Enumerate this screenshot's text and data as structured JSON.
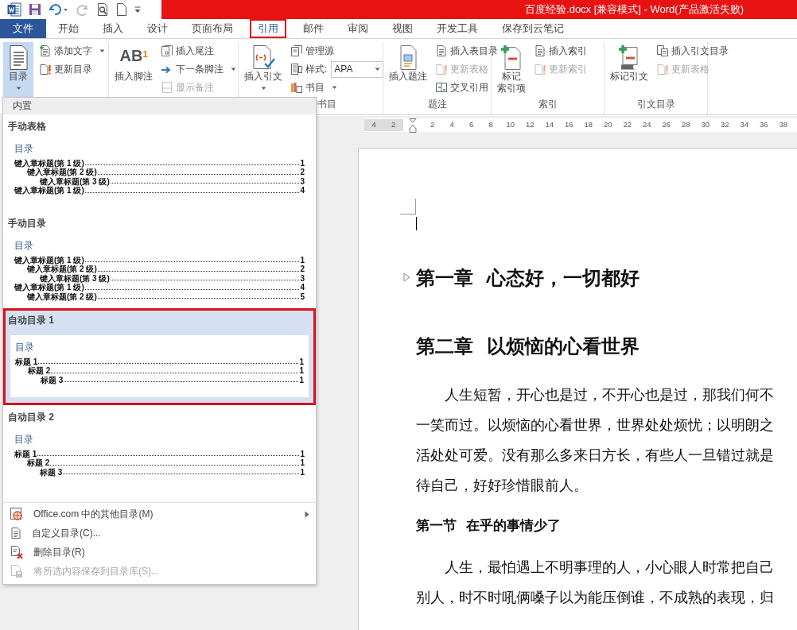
{
  "window": {
    "title": "百度经验.docx [兼容模式] -  Word(产品激活失败)"
  },
  "quick_access": [
    {
      "disabled": false
    },
    {
      "disabled": false
    },
    {
      "disabled": true
    },
    {
      "disabled": false
    },
    {
      "disabled": false
    }
  ],
  "tabs": [
    {
      "label": "文件",
      "kind": "file",
      "selected": false
    },
    {
      "label": "开始",
      "kind": "tab",
      "selected": false
    },
    {
      "label": "插入",
      "kind": "tab",
      "selected": false
    },
    {
      "label": "设计",
      "kind": "tab",
      "selected": false
    },
    {
      "label": "页面布局",
      "kind": "tab",
      "selected": false
    },
    {
      "label": "引用",
      "kind": "tab",
      "selected": true
    },
    {
      "label": "邮件",
      "kind": "tab",
      "selected": false
    },
    {
      "label": "审阅",
      "kind": "tab",
      "selected": false
    },
    {
      "label": "视图",
      "kind": "tab",
      "selected": false
    },
    {
      "label": "开发工具",
      "kind": "tab",
      "selected": false
    },
    {
      "label": "保存到云笔记",
      "kind": "tab",
      "selected": false
    }
  ],
  "ribbon": {
    "groups": [
      {
        "large": {
          "label_lines": [
            "目录"
          ],
          "dropdown": true,
          "expanded": true,
          "disabled": false
        },
        "small": [
          {
            "kind": "button",
            "label": "添加文字",
            "dropdown": true,
            "disabled": false
          },
          {
            "kind": "button",
            "label": "更新目录",
            "dropdown": false,
            "disabled": false
          }
        ]
      },
      {
        "large": {
          "label_lines": [
            "插入脚注"
          ],
          "glyph": "AB$^{1}$",
          "dropdown": false,
          "expanded": false,
          "disabled": false
        },
        "small": [
          {
            "kind": "button",
            "label": "插入尾注",
            "dropdown": false,
            "disabled": false
          },
          {
            "kind": "button",
            "label": "下一条脚注",
            "dropdown": true,
            "disabled": false
          },
          {
            "kind": "button",
            "label": "显示备注",
            "dropdown": false,
            "disabled": true
          }
        ]
      },
      {
        "label": "书目",
        "large": {
          "label_lines": [
            "插入引文"
          ],
          "dropdown": true,
          "expanded": false,
          "disabled": false
        },
        "small": [
          {
            "kind": "button",
            "label": "管理源",
            "dropdown": false,
            "disabled": false
          },
          {
            "kind": "select",
            "label": "样式:",
            "value": "APA"
          },
          {
            "kind": "button",
            "label": "书目",
            "dropdown": true,
            "disabled": false
          }
        ]
      },
      {
        "label": "题注",
        "large": {
          "label_lines": [
            "插入题注"
          ],
          "dropdown": false,
          "expanded": false,
          "disabled": false
        },
        "small": [
          {
            "kind": "button",
            "label": "插入表目录",
            "dropdown": false,
            "disabled": false
          },
          {
            "kind": "button",
            "label": "更新表格",
            "dropdown": false,
            "disabled": true
          },
          {
            "kind": "button",
            "label": "交叉引用",
            "dropdown": false,
            "disabled": false
          }
        ]
      },
      {
        "label": "索引",
        "large": {
          "label_lines": [
            "标记",
            "索引项"
          ],
          "dropdown": false,
          "expanded": false,
          "disabled": false
        },
        "small": [
          {
            "kind": "button",
            "label": "插入索引",
            "dropdown": false,
            "disabled": false
          },
          {
            "kind": "button",
            "label": "更新索引",
            "dropdown": false,
            "disabled": true
          }
        ]
      },
      {
        "label": "引文目录",
        "large": {
          "label_lines": [
            "标记引文"
          ],
          "dropdown": false,
          "expanded": false,
          "disabled": false
        },
        "small": [
          {
            "kind": "button",
            "label": "插入引文目录",
            "dropdown": false,
            "disabled": false
          },
          {
            "kind": "button",
            "label": "更新表格",
            "dropdown": false,
            "disabled": true
          }
        ]
      }
    ]
  },
  "toc_menu": {
    "section_title": "内置",
    "gallery": [
      {
        "title": "手动表格",
        "selected": false,
        "preview": {
          "heading": "目录",
          "entries": [
            {
              "text": "键入章标题(第 1 级)",
              "page": "1",
              "children": [
                {
                  "text": "键入章标题(第 2 级)",
                  "page": "2",
                  "children": [
                    {
                      "text": "键入章标题(第 3 级)",
                      "page": "3"
                    }
                  ]
                }
              ]
            },
            {
              "text": "键入章标题(第 1 级)",
              "page": "4"
            }
          ]
        }
      },
      {
        "title": "手动目录",
        "selected": false,
        "preview": {
          "heading": "目录",
          "entries": [
            {
              "text": "键入章标题(第 1 级)",
              "page": "1",
              "children": [
                {
                  "text": "键入章标题(第 2 级)",
                  "page": "2",
                  "children": [
                    {
                      "text": "键入章标题(第 3 级)",
                      "page": "3"
                    }
                  ]
                }
              ]
            },
            {
              "text": "键入章标题(第 1 级)",
              "page": "4",
              "children": [
                {
                  "text": "键入章标题(第 2 级)",
                  "page": "5"
                }
              ]
            }
          ]
        }
      },
      {
        "title": "自动目录 1",
        "selected": true,
        "preview": {
          "heading": "目录",
          "entries": [
            {
              "text": "标题 1",
              "page": "1",
              "children": [
                {
                  "text": "标题 2",
                  "page": "1",
                  "children": [
                    {
                      "text": "标题 3",
                      "page": "1"
                    }
                  ]
                }
              ]
            }
          ]
        }
      },
      {
        "title": "自动目录 2",
        "selected": false,
        "preview": {
          "heading": "目录",
          "entries": [
            {
              "text": "标题 1",
              "page": "1",
              "children": [
                {
                  "text": "标题 2",
                  "page": "1",
                  "children": [
                    {
                      "text": "标题 3",
                      "page": "1"
                    }
                  ]
                }
              ]
            }
          ]
        }
      }
    ],
    "commands": [
      {
        "label": "Office.com 中的其他目录(M)",
        "submenu": true,
        "disabled": false
      },
      {
        "label": "自定义目录(C)...",
        "submenu": false,
        "disabled": false
      },
      {
        "label": "删除目录(R)",
        "submenu": false,
        "disabled": false
      },
      {
        "label": "将所选内容保存到目录库(S)...",
        "submenu": false,
        "disabled": true
      }
    ]
  },
  "ruler": {
    "left_labels": [
      "4",
      "2"
    ],
    "right_labels": [
      "2",
      "4",
      "6",
      "8",
      "10",
      "12",
      "14",
      "16",
      "18",
      "20",
      "22",
      "24",
      "26",
      "28",
      "30",
      "32",
      "34",
      "36",
      "38"
    ]
  },
  "document": {
    "blocks": [
      {
        "kind": "heading1",
        "text": "第一章  心态好，一切都好",
        "toggle": true
      },
      {
        "kind": "heading1",
        "text": "第二章  以烦恼的心看世界"
      },
      {
        "kind": "paragraph",
        "lines": [
          "人生短暂，开心也是过，不开心也是过，那我们何不",
          "一笑而过。以烦恼的心看世界，世界处处烦忧；以明朗之",
          "活处处可爱。没有那么多来日方长，有些人一旦错过就是",
          "待自己，好好珍惜眼前人。"
        ]
      },
      {
        "kind": "heading2",
        "text": "第一节  在乎的事情少了"
      },
      {
        "kind": "paragraph",
        "lines": [
          "人生，最怕遇上不明事理的人，小心眼人时常把自己",
          "别人，时不时吼俩嗓子以为能压倒谁，不成熟的表现，归"
        ]
      }
    ]
  }
}
